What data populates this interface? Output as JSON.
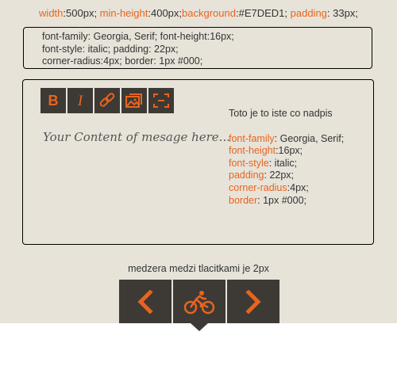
{
  "top_spec": [
    {
      "key": "width",
      "value": ":500px; "
    },
    {
      "key": "min-height",
      "value": ":400px;"
    },
    {
      "key": "background",
      "value": ":#E7DED1; "
    },
    {
      "key": "padding",
      "value": ": 33px;"
    }
  ],
  "box_spec": {
    "lines": [
      "font-family: Georgia, Serif; font-height:16px;",
      "font-style: italic; padding: 22px;",
      "corner-radius:4px; border: 1px #000;"
    ]
  },
  "toolbar": {
    "buttons": [
      {
        "name": "bold-button",
        "icon": "bold-icon",
        "label": "B"
      },
      {
        "name": "italic-button",
        "icon": "italic-icon",
        "label": "I"
      },
      {
        "name": "link-button",
        "icon": "link-icon"
      },
      {
        "name": "image-button",
        "icon": "image-icon"
      },
      {
        "name": "fullscreen-button",
        "icon": "fullscreen-icon"
      }
    ]
  },
  "editor": {
    "placeholder": "Your Content of mesage here..."
  },
  "description": {
    "title": "Toto je to iste co nadpis",
    "props": [
      {
        "key": "font-family",
        "value": ": Georgia, Serif;"
      },
      {
        "key": "font-height",
        "value": ":16px;"
      },
      {
        "key": "font-style",
        "value": ": italic;"
      },
      {
        "key": "padding",
        "value": ": 22px;"
      },
      {
        "key": "corner-radius",
        "value": ":4px;"
      },
      {
        "key": "border",
        "value": ": 1px #000;"
      }
    ]
  },
  "caption": "medzera medzi tlacitkami je 2px",
  "nav": {
    "buttons": [
      {
        "name": "prev-button",
        "icon": "chevron-left-icon"
      },
      {
        "name": "bike-button",
        "icon": "bicycle-icon",
        "active": true
      },
      {
        "name": "next-button",
        "icon": "chevron-right-icon"
      }
    ]
  },
  "colors": {
    "accent": "#E8641E",
    "panel_bg": "#E7E3D9",
    "button_bg": "#3D3935"
  }
}
